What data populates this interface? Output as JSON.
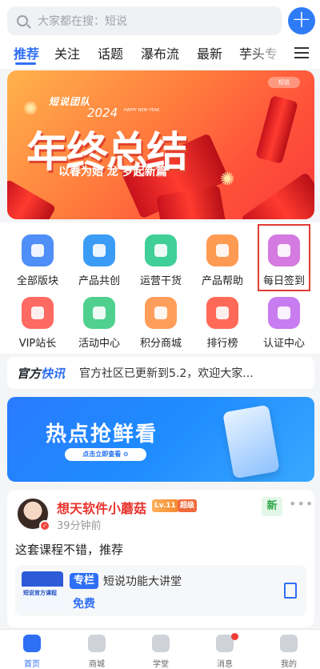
{
  "search": {
    "placeholder": "大家都在搜：短说"
  },
  "header": {
    "tabs": [
      {
        "label": "推荐",
        "active": true
      },
      {
        "label": "关注"
      },
      {
        "label": "话题"
      },
      {
        "label": "瀑布流"
      },
      {
        "label": "最新"
      },
      {
        "label": "芋头专"
      }
    ]
  },
  "banner": {
    "team": "短说团队",
    "year": "2024",
    "subtitle_en": "HAPPY NEW YEAR",
    "title": "年终总结",
    "slogan": "以春为始 龙 岁起新篇",
    "badge": "短说"
  },
  "grid": {
    "items": [
      {
        "label": "全部版块",
        "icon": "grid-icon",
        "color": "#4f8ff7"
      },
      {
        "label": "产品共创",
        "icon": "chat-icon",
        "color": "#3b9cf5"
      },
      {
        "label": "运营干货",
        "icon": "book-star-icon",
        "color": "#3fcf97"
      },
      {
        "label": "产品帮助",
        "icon": "video-icon",
        "color": "#ff9a52"
      },
      {
        "label": "每日签到",
        "icon": "calendar-icon",
        "color": "#d57ae0"
      },
      {
        "label": "VIP站长",
        "icon": "crown-icon",
        "color": "#ff6a62"
      },
      {
        "label": "活动中心",
        "icon": "megaphone-icon",
        "color": "#4fd08f"
      },
      {
        "label": "积分商城",
        "icon": "bag-icon",
        "color": "#ff9e5a"
      },
      {
        "label": "排行榜",
        "icon": "trophy-icon",
        "color": "#ff6a58"
      },
      {
        "label": "认证中心",
        "icon": "layers-icon",
        "color": "#c77df0"
      }
    ]
  },
  "news": {
    "tag_a": "官方",
    "tag_b": "快讯",
    "text": "官方社区已更新到5.2，欢迎大家..."
  },
  "promo": {
    "title": "热点抢鲜看",
    "button": "点击立即查看 ⊙"
  },
  "post": {
    "author": "想天软件小蘑菇",
    "level": "Lv.11",
    "vip": "超级",
    "badge": "新",
    "more": "•••",
    "time": "39分钟前",
    "content": "这套课程不错，推荐",
    "attachment": {
      "thumb_text": "短说官方课程",
      "tag": "专栏",
      "title": "短说功能大讲堂",
      "price": "免费"
    }
  },
  "bottom_nav": [
    {
      "label": "首页",
      "icon": "home-icon",
      "active": true
    },
    {
      "label": "商城",
      "icon": "shop-icon"
    },
    {
      "label": "学堂",
      "icon": "graduation-icon"
    },
    {
      "label": "消息",
      "icon": "message-icon",
      "dot": true
    },
    {
      "label": "我的",
      "icon": "user-icon"
    }
  ]
}
